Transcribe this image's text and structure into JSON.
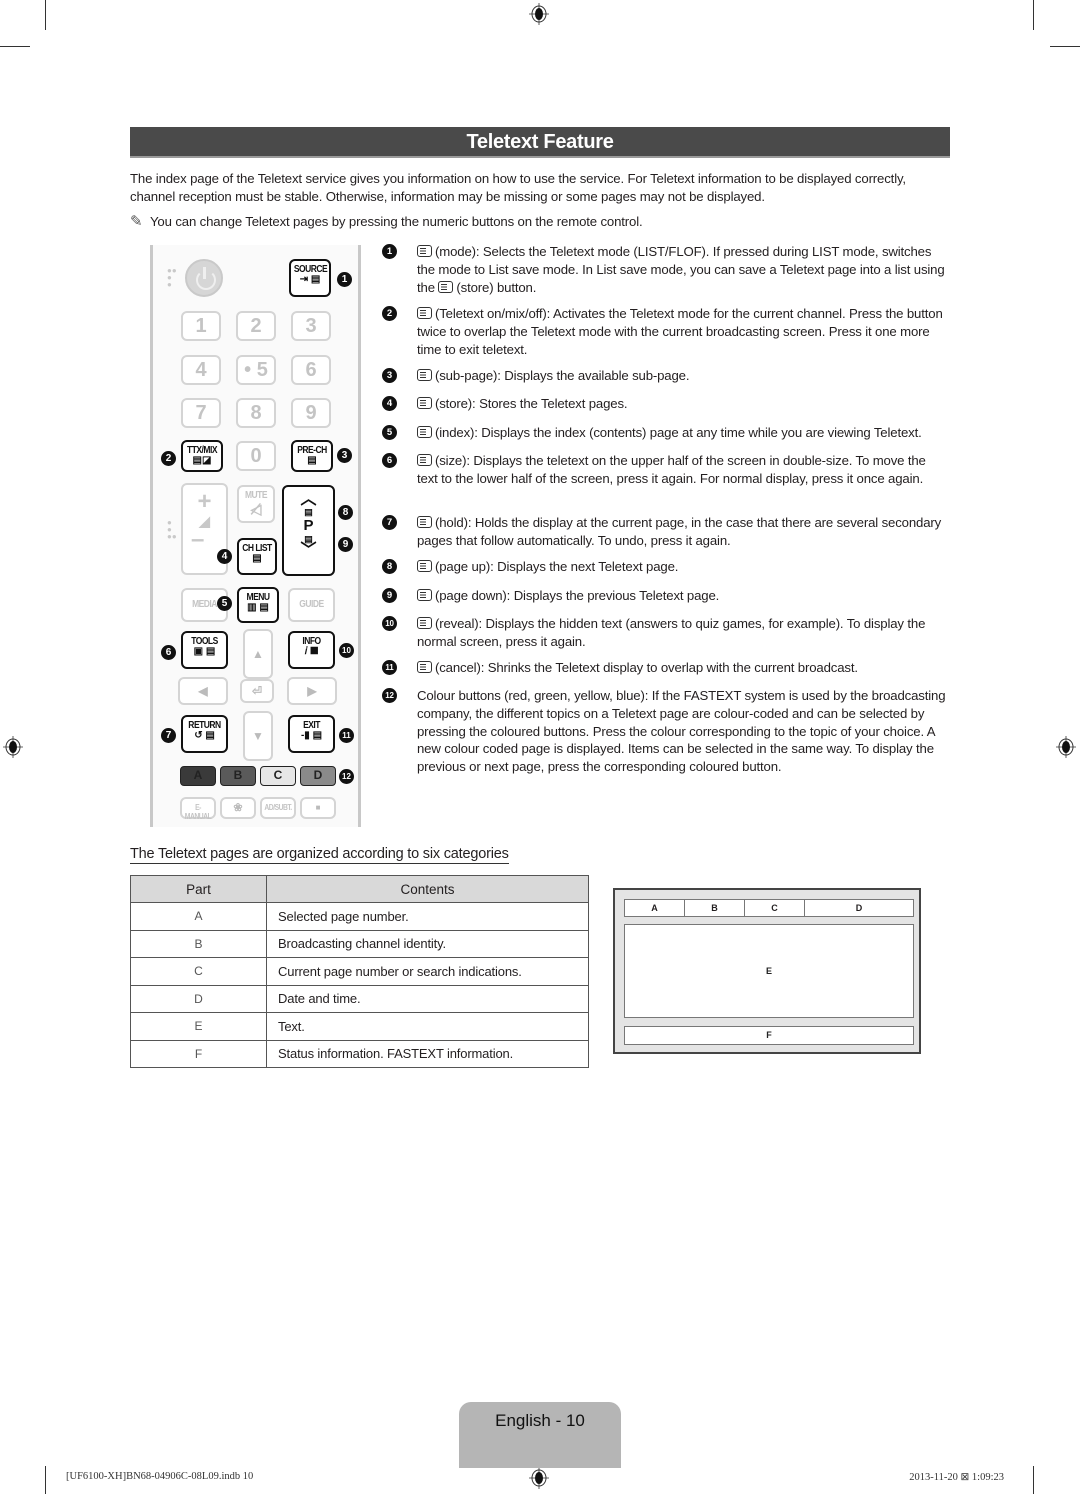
{
  "title": "Teletext Feature",
  "intro": "The index page of the Teletext service gives you information on how to use the service. For Teletext information to be displayed correctly, channel reception must be stable. Otherwise, information may be missing or some pages may not be displayed.",
  "note": {
    "icon": "pencil-note-icon",
    "text": "You can change Teletext pages by pressing the numeric buttons on the remote control."
  },
  "remote": {
    "buttons": {
      "source": "SOURCE",
      "n1": "1",
      "n2": "2",
      "n3": "3",
      "n4": "4",
      "n5": "• 5",
      "n6": "6",
      "n7": "7",
      "n8": "8",
      "n9": "9",
      "ttx": "TTX/MIX",
      "n0": "0",
      "prech": "PRE-CH",
      "mute": "MUTE",
      "p": "P",
      "chlist": "CH LIST",
      "media": "MEDIA",
      "menu": "MENU",
      "guide": "GUIDE",
      "tools": "TOOLS",
      "info": "INFO",
      "ret": "RETURN",
      "exit": "EXIT",
      "a": "A",
      "b": "B",
      "c": "C",
      "d": "D",
      "emanual": "E-MANUAL",
      "adsubt": "AD/SUBT."
    },
    "color_buttons": {
      "a": "#3a3a3a",
      "b": "#5a5a5a",
      "c": "#e6e6e6",
      "d": "#8a8a8a"
    },
    "callouts": [
      "1",
      "2",
      "3",
      "4",
      "5",
      "6",
      "7",
      "8",
      "9",
      "10",
      "11",
      "12"
    ]
  },
  "items": [
    {
      "num": "1",
      "icon": "mode-icon",
      "text": "(mode): Selects the Teletext mode (LIST/FLOF). If pressed during LIST mode, switches the mode to List save mode. In List save mode, you can save a Teletext page into a list using the",
      "icon2": "store-icon",
      "text2": "(store) button."
    },
    {
      "num": "2",
      "icon": "teletext-mix-icon",
      "text": "(Teletext on/mix/off): Activates the Teletext mode for the current channel. Press the button twice to overlap the Teletext mode with the current broadcasting screen. Press it one more time to exit teletext."
    },
    {
      "num": "3",
      "icon": "sub-page-icon",
      "text": "(sub-page): Displays the available sub-page."
    },
    {
      "num": "4",
      "icon": "store-icon",
      "text": "(store): Stores the Teletext pages."
    },
    {
      "num": "5",
      "icon": "index-icon",
      "text": "(index): Displays the index (contents) page at any time while you are viewing Teletext."
    },
    {
      "num": "6",
      "icon": "size-icon",
      "text": "(size): Displays the teletext on the upper half of the screen in double-size. To move the text to the lower half of the screen, press it again. For normal display, press it once again."
    },
    {
      "num": "7",
      "icon": "hold-icon",
      "text": "(hold): Holds the display at the current page, in the case that there are several secondary pages that follow automatically. To undo, press it again."
    },
    {
      "num": "8",
      "icon": "page-up-icon",
      "text": "(page up): Displays the next Teletext page."
    },
    {
      "num": "9",
      "icon": "page-down-icon",
      "text": "(page down): Displays the previous Teletext page."
    },
    {
      "num": "10",
      "icon": "reveal-icon",
      "text": "(reveal): Displays the hidden text (answers to quiz games, for example). To display the normal screen, press it again."
    },
    {
      "num": "11",
      "icon": "cancel-icon",
      "text": "(cancel): Shrinks the Teletext display to overlap with the current broadcast."
    },
    {
      "num": "12",
      "icon": "",
      "text": "Colour buttons (red, green, yellow, blue): If the FASTEXT system is used by the broadcasting company, the different topics on a Teletext page are colour-coded and can be selected by pressing the coloured buttons. Press the colour corresponding to the topic of your choice. A new colour coded page is displayed. Items can be selected in the same way. To display the previous or next page, press the corresponding coloured button."
    }
  ],
  "section_heading": "The Teletext pages are organized according to six categories",
  "table": {
    "headers": [
      "Part",
      "Contents"
    ],
    "rows": [
      {
        "part": "A",
        "contents": "Selected page number."
      },
      {
        "part": "B",
        "contents": "Broadcasting channel identity."
      },
      {
        "part": "C",
        "contents": "Current page number or search indications."
      },
      {
        "part": "D",
        "contents": "Date and time."
      },
      {
        "part": "E",
        "contents": "Text."
      },
      {
        "part": "F",
        "contents": "Status information. FASTEXT information."
      }
    ]
  },
  "diagram": {
    "a": "A",
    "b": "B",
    "c": "C",
    "d": "D",
    "e": "E",
    "f": "F"
  },
  "page_label": "English - 10",
  "footer": {
    "file": "[UF6100-XH]BN68-04906C-08L09.indb   10",
    "timestamp": "2013-11-20   ⊠ 1:09:23"
  }
}
